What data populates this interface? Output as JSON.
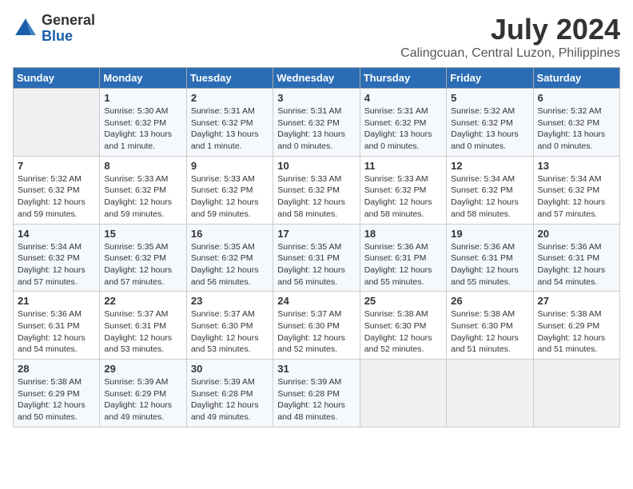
{
  "header": {
    "logo": {
      "general": "General",
      "blue": "Blue"
    },
    "title": "July 2024",
    "location": "Calingcuan, Central Luzon, Philippines"
  },
  "days_of_week": [
    "Sunday",
    "Monday",
    "Tuesday",
    "Wednesday",
    "Thursday",
    "Friday",
    "Saturday"
  ],
  "weeks": [
    [
      {
        "num": "",
        "detail": ""
      },
      {
        "num": "1",
        "detail": "Sunrise: 5:30 AM\nSunset: 6:32 PM\nDaylight: 13 hours\nand 1 minute."
      },
      {
        "num": "2",
        "detail": "Sunrise: 5:31 AM\nSunset: 6:32 PM\nDaylight: 13 hours\nand 1 minute."
      },
      {
        "num": "3",
        "detail": "Sunrise: 5:31 AM\nSunset: 6:32 PM\nDaylight: 13 hours\nand 0 minutes."
      },
      {
        "num": "4",
        "detail": "Sunrise: 5:31 AM\nSunset: 6:32 PM\nDaylight: 13 hours\nand 0 minutes."
      },
      {
        "num": "5",
        "detail": "Sunrise: 5:32 AM\nSunset: 6:32 PM\nDaylight: 13 hours\nand 0 minutes."
      },
      {
        "num": "6",
        "detail": "Sunrise: 5:32 AM\nSunset: 6:32 PM\nDaylight: 13 hours\nand 0 minutes."
      }
    ],
    [
      {
        "num": "7",
        "detail": "Sunrise: 5:32 AM\nSunset: 6:32 PM\nDaylight: 12 hours\nand 59 minutes."
      },
      {
        "num": "8",
        "detail": "Sunrise: 5:33 AM\nSunset: 6:32 PM\nDaylight: 12 hours\nand 59 minutes."
      },
      {
        "num": "9",
        "detail": "Sunrise: 5:33 AM\nSunset: 6:32 PM\nDaylight: 12 hours\nand 59 minutes."
      },
      {
        "num": "10",
        "detail": "Sunrise: 5:33 AM\nSunset: 6:32 PM\nDaylight: 12 hours\nand 58 minutes."
      },
      {
        "num": "11",
        "detail": "Sunrise: 5:33 AM\nSunset: 6:32 PM\nDaylight: 12 hours\nand 58 minutes."
      },
      {
        "num": "12",
        "detail": "Sunrise: 5:34 AM\nSunset: 6:32 PM\nDaylight: 12 hours\nand 58 minutes."
      },
      {
        "num": "13",
        "detail": "Sunrise: 5:34 AM\nSunset: 6:32 PM\nDaylight: 12 hours\nand 57 minutes."
      }
    ],
    [
      {
        "num": "14",
        "detail": "Sunrise: 5:34 AM\nSunset: 6:32 PM\nDaylight: 12 hours\nand 57 minutes."
      },
      {
        "num": "15",
        "detail": "Sunrise: 5:35 AM\nSunset: 6:32 PM\nDaylight: 12 hours\nand 57 minutes."
      },
      {
        "num": "16",
        "detail": "Sunrise: 5:35 AM\nSunset: 6:32 PM\nDaylight: 12 hours\nand 56 minutes."
      },
      {
        "num": "17",
        "detail": "Sunrise: 5:35 AM\nSunset: 6:31 PM\nDaylight: 12 hours\nand 56 minutes."
      },
      {
        "num": "18",
        "detail": "Sunrise: 5:36 AM\nSunset: 6:31 PM\nDaylight: 12 hours\nand 55 minutes."
      },
      {
        "num": "19",
        "detail": "Sunrise: 5:36 AM\nSunset: 6:31 PM\nDaylight: 12 hours\nand 55 minutes."
      },
      {
        "num": "20",
        "detail": "Sunrise: 5:36 AM\nSunset: 6:31 PM\nDaylight: 12 hours\nand 54 minutes."
      }
    ],
    [
      {
        "num": "21",
        "detail": "Sunrise: 5:36 AM\nSunset: 6:31 PM\nDaylight: 12 hours\nand 54 minutes."
      },
      {
        "num": "22",
        "detail": "Sunrise: 5:37 AM\nSunset: 6:31 PM\nDaylight: 12 hours\nand 53 minutes."
      },
      {
        "num": "23",
        "detail": "Sunrise: 5:37 AM\nSunset: 6:30 PM\nDaylight: 12 hours\nand 53 minutes."
      },
      {
        "num": "24",
        "detail": "Sunrise: 5:37 AM\nSunset: 6:30 PM\nDaylight: 12 hours\nand 52 minutes."
      },
      {
        "num": "25",
        "detail": "Sunrise: 5:38 AM\nSunset: 6:30 PM\nDaylight: 12 hours\nand 52 minutes."
      },
      {
        "num": "26",
        "detail": "Sunrise: 5:38 AM\nSunset: 6:30 PM\nDaylight: 12 hours\nand 51 minutes."
      },
      {
        "num": "27",
        "detail": "Sunrise: 5:38 AM\nSunset: 6:29 PM\nDaylight: 12 hours\nand 51 minutes."
      }
    ],
    [
      {
        "num": "28",
        "detail": "Sunrise: 5:38 AM\nSunset: 6:29 PM\nDaylight: 12 hours\nand 50 minutes."
      },
      {
        "num": "29",
        "detail": "Sunrise: 5:39 AM\nSunset: 6:29 PM\nDaylight: 12 hours\nand 49 minutes."
      },
      {
        "num": "30",
        "detail": "Sunrise: 5:39 AM\nSunset: 6:28 PM\nDaylight: 12 hours\nand 49 minutes."
      },
      {
        "num": "31",
        "detail": "Sunrise: 5:39 AM\nSunset: 6:28 PM\nDaylight: 12 hours\nand 48 minutes."
      },
      {
        "num": "",
        "detail": ""
      },
      {
        "num": "",
        "detail": ""
      },
      {
        "num": "",
        "detail": ""
      }
    ]
  ]
}
